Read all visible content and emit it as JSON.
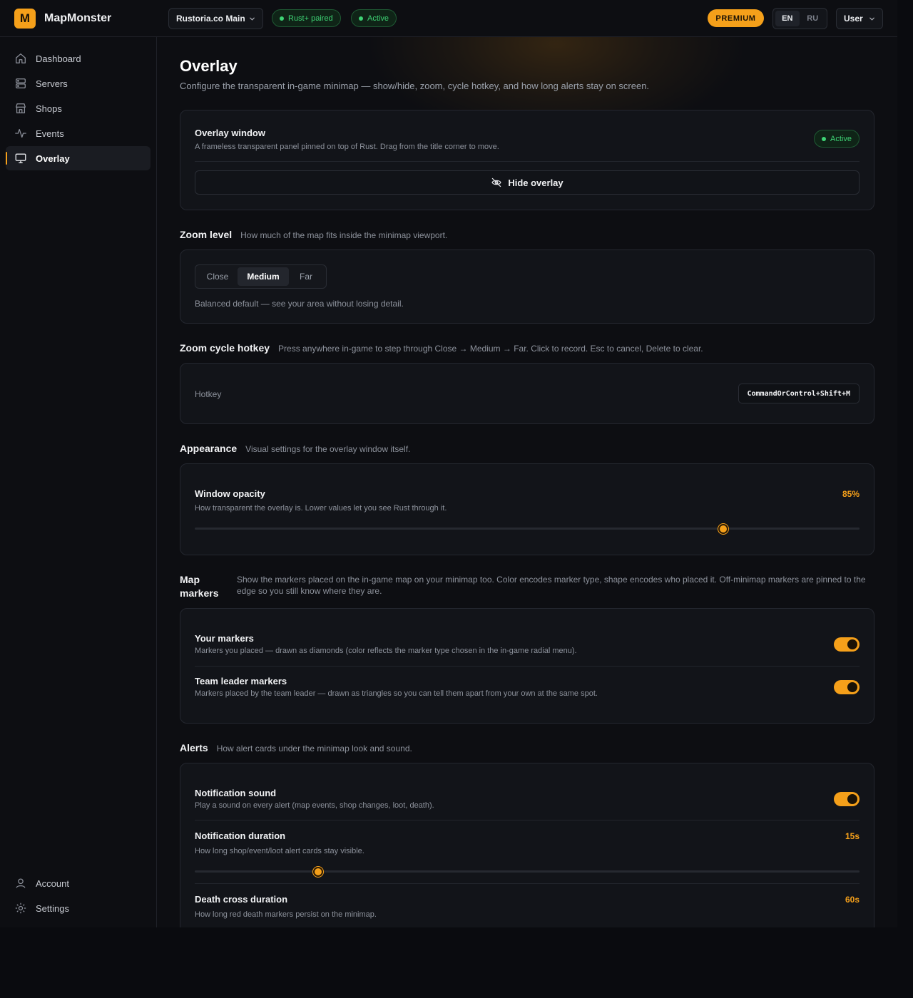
{
  "app": {
    "logo_letter": "M",
    "brand": "MapMonster"
  },
  "header": {
    "server": "Rustoria.co Main",
    "pill_paired": "Rust+ paired",
    "pill_active": "Active",
    "premium": "PREMIUM",
    "lang": [
      "EN",
      "RU"
    ],
    "lang_selected": "EN",
    "user": "User"
  },
  "sidebar": {
    "items": [
      {
        "label": "Dashboard",
        "icon": "home-icon"
      },
      {
        "label": "Servers",
        "icon": "server-icon"
      },
      {
        "label": "Shops",
        "icon": "store-icon"
      },
      {
        "label": "Events",
        "icon": "activity-icon"
      },
      {
        "label": "Overlay",
        "icon": "monitor-icon",
        "active": true
      }
    ],
    "bottom": [
      {
        "label": "Account",
        "icon": "user-icon"
      },
      {
        "label": "Settings",
        "icon": "gear-icon"
      }
    ]
  },
  "page": {
    "title": "Overlay",
    "subtitle": "Configure the transparent in-game minimap — show/hide, zoom, cycle hotkey, and how long alerts stay on screen."
  },
  "overlay_window": {
    "title": "Overlay window",
    "desc": "A frameless transparent panel pinned on top of Rust. Drag from the title corner to move.",
    "status": "Active",
    "button": "Hide overlay"
  },
  "zoom": {
    "title": "Zoom level",
    "desc": "How much of the map fits inside the minimap viewport.",
    "options": [
      "Close",
      "Medium",
      "Far"
    ],
    "selected": "Medium",
    "hint": "Balanced default — see your area without losing detail."
  },
  "hotkey": {
    "title": "Zoom cycle hotkey",
    "desc": "Press anywhere in-game to step through Close → Medium → Far. Click to record. Esc to cancel, Delete to clear.",
    "label": "Hotkey",
    "value": "CommandOrControl+Shift+M"
  },
  "appearance": {
    "title": "Appearance",
    "desc": "Visual settings for the overlay window itself.",
    "opacity_title": "Window opacity",
    "opacity_desc": "How transparent the overlay is. Lower values let you see Rust through it.",
    "opacity_value": "85%",
    "opacity_fraction": 0.795
  },
  "markers": {
    "title": "Map markers",
    "desc": "Show the markers placed on the in-game map on your minimap too. Color encodes marker type, shape encodes who placed it. Off-minimap markers are pinned to the edge so you still know where they are.",
    "yours_title": "Your markers",
    "yours_desc": "Markers you placed — drawn as diamonds (color reflects the marker type chosen in the in-game radial menu).",
    "yours_on": true,
    "leader_title": "Team leader markers",
    "leader_desc": "Markers placed by the team leader — drawn as triangles so you can tell them apart from your own at the same spot.",
    "leader_on": true
  },
  "alerts": {
    "title": "Alerts",
    "desc": "How alert cards under the minimap look and sound.",
    "sound_title": "Notification sound",
    "sound_desc": "Play a sound on every alert (map events, shop changes, loot, death).",
    "sound_on": true,
    "duration_title": "Notification duration",
    "duration_desc": "How long shop/event/loot alert cards stay visible.",
    "duration_value": "15s",
    "duration_fraction": 0.186,
    "death_title": "Death cross duration",
    "death_desc": "How long red death markers persist on the minimap.",
    "death_value": "60s"
  },
  "colors": {
    "accent": "#f5a01a",
    "success": "#3ed274",
    "bg": "#0d0e12",
    "card": "#121419"
  }
}
